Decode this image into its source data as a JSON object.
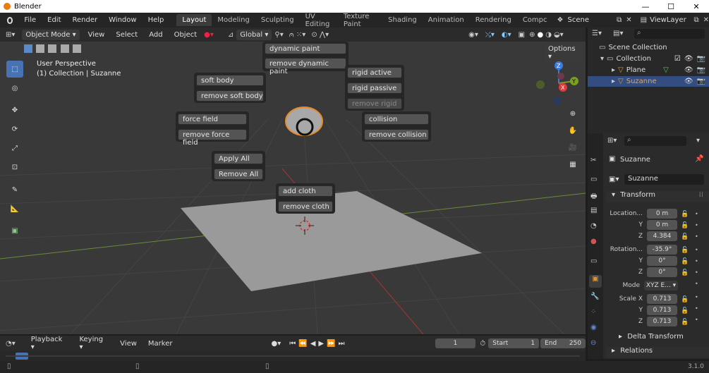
{
  "window": {
    "title": "Blender",
    "min_glyph": "—",
    "max_glyph": "☐",
    "close_glyph": "✕"
  },
  "menu": {
    "items": [
      "File",
      "Edit",
      "Render",
      "Window",
      "Help"
    ]
  },
  "workspaces": {
    "tabs": [
      "Layout",
      "Modeling",
      "Sculpting",
      "UV Editing",
      "Texture Paint",
      "Shading",
      "Animation",
      "Rendering",
      "Compc"
    ],
    "active": "Layout"
  },
  "scene": {
    "name": "Scene",
    "view_layer": "ViewLayer"
  },
  "viewport_header": {
    "mode": "Object Mode",
    "view": "View",
    "select": "Select",
    "add": "Add",
    "object": "Object",
    "orientation": "Global",
    "options": "Options"
  },
  "viewport": {
    "perspective": "User Perspective",
    "collection_info": "(1) Collection | Suzanne"
  },
  "popup": {
    "dynamic_paint": "dynamic paint",
    "remove_dynamic_paint": "remove dynamic paint",
    "soft_body": "soft body",
    "remove_soft_body": "remove soft body",
    "rigid_active": "rigid active",
    "rigid_passive": "rigid passive",
    "remove_rigid": "remove rigid",
    "force_field": "force field",
    "remove_force_field": "remove force field",
    "collision": "collision",
    "remove_collision": "remove collision",
    "apply_all": "Apply All",
    "remove_all": "Remove All",
    "add_cloth": "add cloth",
    "remove_cloth": "remove cloth"
  },
  "gizmo": {
    "z": "Z",
    "y": "Y",
    "x": "X"
  },
  "outliner": {
    "scene_collection": "Scene Collection",
    "collection": "Collection",
    "plane": "Plane",
    "suzanne": "Suzanne"
  },
  "properties": {
    "object_name": "Suzanne",
    "data_name": "Suzanne",
    "transform_title": "Transform",
    "location_label": "Location...",
    "loc": [
      "0 m",
      "0 m",
      "4.384"
    ],
    "rotation_label": "Rotation...",
    "rot": [
      "-35.9°",
      "0°",
      "0°"
    ],
    "mode_label": "Mode",
    "mode_value": "XYZ E...",
    "scale_label": "Scale X",
    "scale": [
      "0.713",
      "0.713",
      "0.713"
    ],
    "y_label": "Y",
    "z_label": "Z",
    "delta_transform": "Delta Transform",
    "relations": "Relations"
  },
  "timeline": {
    "playback": "Playback",
    "keying": "Keying",
    "view": "View",
    "marker": "Marker",
    "current_frame": "1",
    "start_label": "Start",
    "start": "1",
    "end_label": "End",
    "end": "250"
  },
  "status": {
    "version": "3.1.0"
  }
}
